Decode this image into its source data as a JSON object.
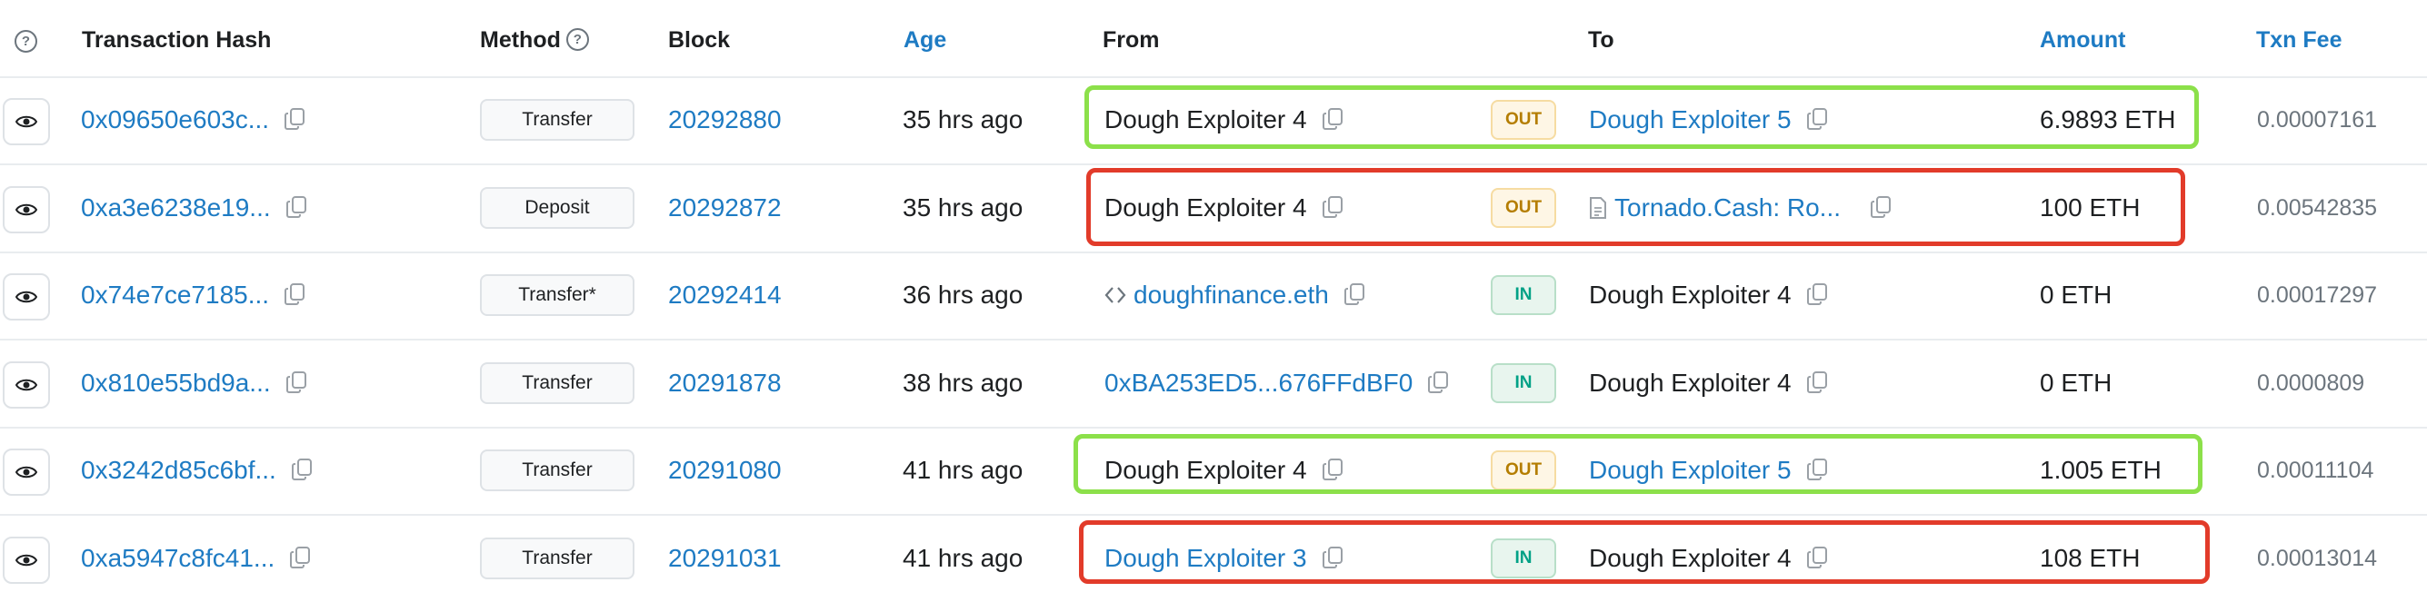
{
  "header": {
    "hash": "Transaction Hash",
    "method": "Method",
    "block": "Block",
    "age": "Age",
    "from": "From",
    "to": "To",
    "amount": "Amount",
    "fee": "Txn Fee",
    "help_glyph": "?"
  },
  "rows": [
    {
      "hash": "0x09650e603c...",
      "method": "Transfer",
      "block": "20292880",
      "age": "35 hrs ago",
      "from": "Dough Exploiter 4",
      "direction": "OUT",
      "to": "Dough Exploiter 5",
      "amount": "6.9893 ETH",
      "fee": "0.00007161"
    },
    {
      "hash": "0xa3e6238e19...",
      "method": "Deposit",
      "block": "20292872",
      "age": "35 hrs ago",
      "from": "Dough Exploiter 4",
      "direction": "OUT",
      "to": "Tornado.Cash: Ro...",
      "amount": "100 ETH",
      "fee": "0.00542835"
    },
    {
      "hash": "0x74e7ce7185...",
      "method": "Transfer*",
      "block": "20292414",
      "age": "36 hrs ago",
      "from": "doughfinance.eth",
      "direction": "IN",
      "to": "Dough Exploiter 4",
      "amount": "0 ETH",
      "fee": "0.00017297"
    },
    {
      "hash": "0x810e55bd9a...",
      "method": "Transfer",
      "block": "20291878",
      "age": "38 hrs ago",
      "from": "0xBA253ED5...676FFdBF0",
      "direction": "IN",
      "to": "Dough Exploiter 4",
      "amount": "0 ETH",
      "fee": "0.0000809"
    },
    {
      "hash": "0x3242d85c6bf...",
      "method": "Transfer",
      "block": "20291080",
      "age": "41 hrs ago",
      "from": "Dough Exploiter 4",
      "direction": "OUT",
      "to": "Dough Exploiter 5",
      "amount": "1.005 ETH",
      "fee": "0.00011104"
    },
    {
      "hash": "0xa5947c8fc41...",
      "method": "Transfer",
      "block": "20291031",
      "age": "41 hrs ago",
      "from": "Dough Exploiter 3",
      "direction": "IN",
      "to": "Dough Exploiter 4",
      "amount": "108 ETH",
      "fee": "0.00013014"
    }
  ],
  "colors": {
    "link": "#1e7bc3",
    "highlight_green": "#8ce04a",
    "highlight_red": "#e23b2a",
    "badge_out": "#b47d00",
    "badge_in": "#00a186"
  },
  "icons": {
    "view": "eye-icon",
    "copy": "copy-icon",
    "contract": "code-icon",
    "document": "document-icon",
    "help": "question-circle-icon"
  }
}
